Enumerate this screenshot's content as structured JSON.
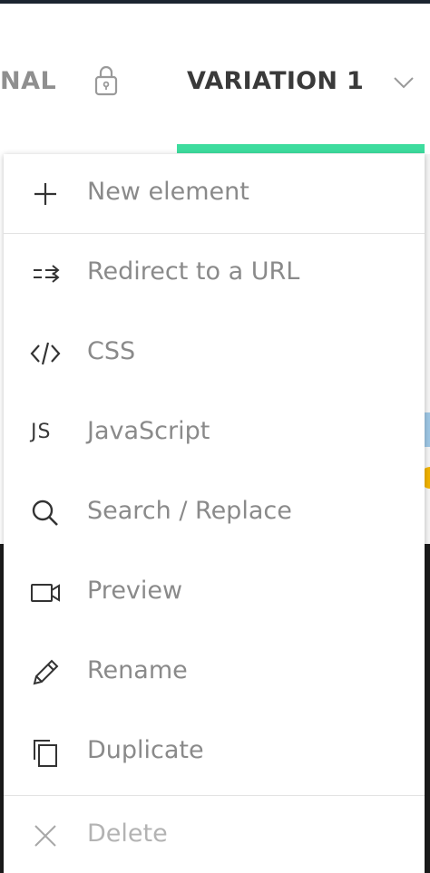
{
  "tabs": {
    "original_label": "NAL",
    "variation_label": "VARIATION 1",
    "accent_color": "#3ddc9e"
  },
  "menu": {
    "items": [
      {
        "label": "New element",
        "icon": "plus-icon"
      },
      {
        "label": "Redirect to a URL",
        "icon": "redirect-icon"
      },
      {
        "label": "CSS",
        "icon": "code-icon"
      },
      {
        "label": "JavaScript",
        "icon": "js-icon",
        "icon_text": "JS"
      },
      {
        "label": "Search / Replace",
        "icon": "search-icon"
      },
      {
        "label": "Preview",
        "icon": "video-camera-icon"
      },
      {
        "label": "Rename",
        "icon": "pencil-icon"
      },
      {
        "label": "Duplicate",
        "icon": "copy-icon"
      },
      {
        "label": "Delete",
        "icon": "close-icon"
      }
    ]
  }
}
